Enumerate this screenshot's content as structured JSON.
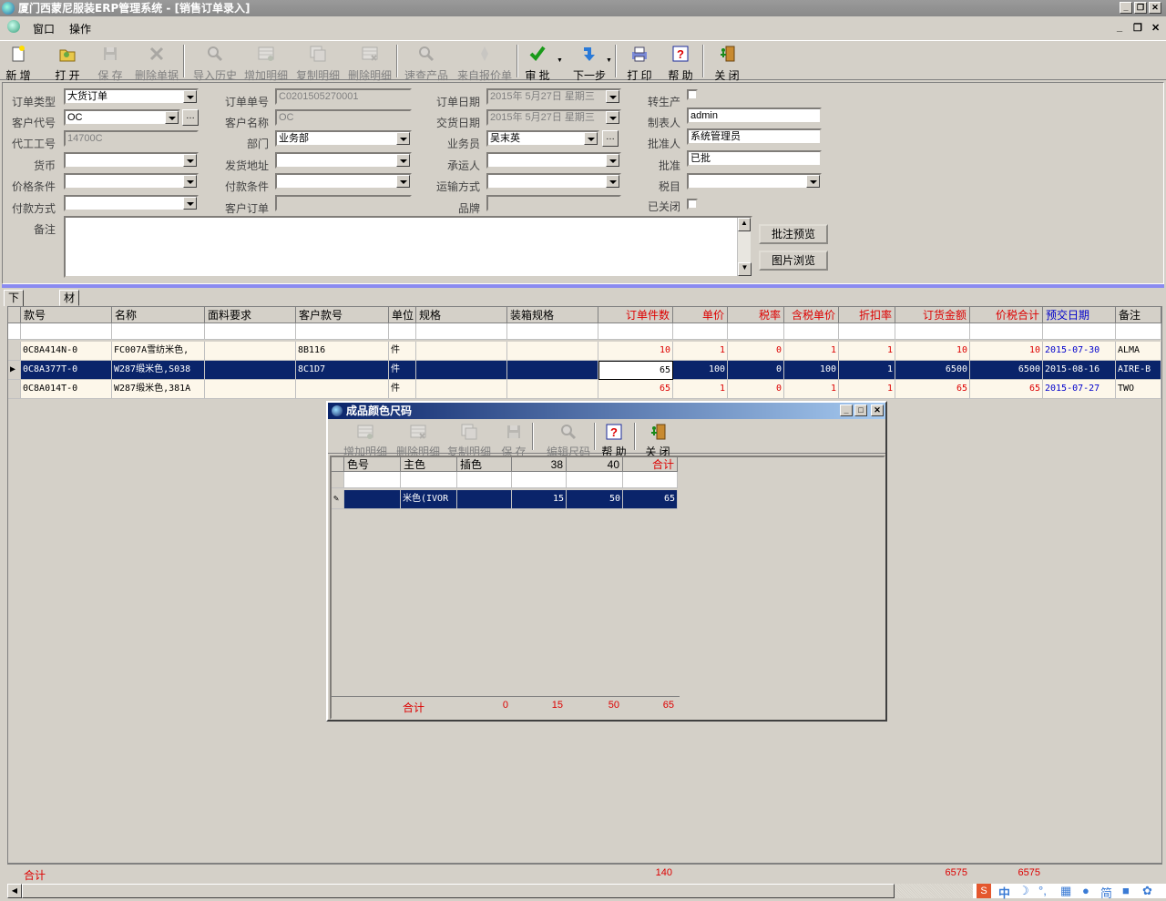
{
  "window": {
    "title": "厦门西蒙尼服装ERP管理系统 - [销售订单录入]",
    "min": "_",
    "restore": "❐",
    "close": "✕"
  },
  "menu": {
    "window": "窗口",
    "operate": "操作"
  },
  "toolbar": [
    {
      "id": "new",
      "label": "新  增",
      "icon": "new-icon",
      "enabled": true
    },
    {
      "id": "open",
      "label": "打  开",
      "icon": "open-icon",
      "enabled": true
    },
    {
      "id": "save",
      "label": "保  存",
      "icon": "save-icon",
      "enabled": false
    },
    {
      "id": "delete",
      "label": "删除单据",
      "icon": "delete-icon",
      "enabled": false
    },
    {
      "id": "import",
      "label": "导入历史",
      "icon": "search-icon",
      "enabled": false
    },
    {
      "id": "adddetail",
      "label": "增加明细",
      "icon": "add-detail-icon",
      "enabled": false
    },
    {
      "id": "copydetail",
      "label": "复制明细",
      "icon": "copy-detail-icon",
      "enabled": false
    },
    {
      "id": "deldetail",
      "label": "删除明细",
      "icon": "delete-detail-icon",
      "enabled": false
    },
    {
      "id": "query",
      "label": "速查产品",
      "icon": "search-icon",
      "enabled": false
    },
    {
      "id": "quote",
      "label": "来自报价单",
      "icon": "quote-icon",
      "enabled": false
    },
    {
      "id": "approve",
      "label": "审  批",
      "icon": "check-icon",
      "enabled": true
    },
    {
      "id": "next",
      "label": "下一步",
      "icon": "next-icon",
      "enabled": true
    },
    {
      "id": "print",
      "label": "打  印",
      "icon": "print-icon",
      "enabled": true
    },
    {
      "id": "help",
      "label": "帮  助",
      "icon": "help-icon",
      "enabled": true
    },
    {
      "id": "close",
      "label": "关  闭",
      "icon": "exit-icon",
      "enabled": true
    }
  ],
  "form": {
    "order_type": {
      "label": "订单类型",
      "value": "大货订单"
    },
    "customer_code": {
      "label": "客户代号",
      "value": "OC"
    },
    "oem_no": {
      "label": "代工工号",
      "value": "14700C"
    },
    "currency": {
      "label": "货币",
      "value": ""
    },
    "price_term": {
      "label": "价格条件",
      "value": ""
    },
    "pay_method": {
      "label": "付款方式",
      "value": ""
    },
    "remark": {
      "label": "备注",
      "value": ""
    },
    "order_no": {
      "label": "订单单号",
      "value": "C0201505270001"
    },
    "customer_name": {
      "label": "客户名称",
      "value": "OC"
    },
    "dept": {
      "label": "部门",
      "value": "业务部"
    },
    "ship_addr": {
      "label": "发货地址",
      "value": ""
    },
    "pay_term": {
      "label": "付款条件",
      "value": ""
    },
    "cust_order": {
      "label": "客户订单",
      "value": ""
    },
    "order_date": {
      "label": "订单日期",
      "value": "2015年 5月27日 星期三"
    },
    "deliver_date": {
      "label": "交货日期",
      "value": "2015年 5月27日 星期三"
    },
    "salesman": {
      "label": "业务员",
      "value": "吴末英"
    },
    "carrier": {
      "label": "承运人",
      "value": ""
    },
    "transport": {
      "label": "运输方式",
      "value": ""
    },
    "brand": {
      "label": "品牌",
      "value": ""
    },
    "to_production": {
      "label": "转生产"
    },
    "maker": {
      "label": "制表人",
      "value": "admin"
    },
    "approver": {
      "label": "批准人",
      "value": "系统管理员"
    },
    "approve": {
      "label": "批准",
      "value": "已批"
    },
    "tax_item": {
      "label": "税目",
      "value": ""
    },
    "closed": {
      "label": "已关闭"
    },
    "btn_note_preview": "批注预览",
    "btn_image_browse": "图片浏览"
  },
  "tabs": [
    "下单明细",
    "材料指定"
  ],
  "grid": {
    "headers": [
      "款号",
      "名称",
      "面料要求",
      "客户款号",
      "单位",
      "规格",
      "装箱规格",
      "订单件数",
      "单价",
      "税率",
      "含税单价",
      "折扣率",
      "订货金额",
      "价税合计",
      "预交日期",
      "备注"
    ],
    "rows": [
      [
        "0C8A414N-0",
        "FC007A雪纺米色,",
        "",
        "8B116",
        "件",
        "",
        "",
        "10",
        "1",
        "0",
        "1",
        "1",
        "10",
        "10",
        "2015-07-30",
        "ALMA"
      ],
      [
        "0C8A377T-0",
        "W287缎米色,S038",
        "",
        "8C1D7",
        "件",
        "",
        "",
        "65",
        "100",
        "0",
        "100",
        "1",
        "6500",
        "6500",
        "2015-08-16",
        "AIRE-B"
      ],
      [
        "0C8A014T-0",
        "W287缎米色,381A",
        "",
        "",
        "件",
        "",
        "",
        "65",
        "1",
        "0",
        "1",
        "1",
        "65",
        "65",
        "2015-07-27",
        "TWO"
      ]
    ],
    "total_label": "合计",
    "total_qty": "140",
    "total_amount": "6575",
    "total_tax": "6575"
  },
  "dialog": {
    "title": "成品颜色尺码",
    "toolbar": [
      {
        "label": "增加明细",
        "icon": "add-detail-icon",
        "enabled": false
      },
      {
        "label": "删除明细",
        "icon": "delete-detail-icon",
        "enabled": false
      },
      {
        "label": "复制明细",
        "icon": "copy-detail-icon",
        "enabled": false
      },
      {
        "label": "保  存",
        "icon": "save-icon",
        "enabled": false
      },
      {
        "label": "编辑尺码",
        "icon": "search-icon",
        "enabled": false
      },
      {
        "label": "帮  助",
        "icon": "help-icon",
        "enabled": true
      },
      {
        "label": "关  闭",
        "icon": "exit-icon",
        "enabled": true
      }
    ],
    "headers": [
      "色号",
      "主色",
      "插色",
      "38",
      "40",
      "合计"
    ],
    "row": [
      "",
      "米色(IVOR",
      "",
      "15",
      "50",
      "65"
    ],
    "total": {
      "label": "合计",
      "c1": "0",
      "c2": "15",
      "c3": "50",
      "c4": "65"
    }
  },
  "ime": {
    "text": "中"
  }
}
